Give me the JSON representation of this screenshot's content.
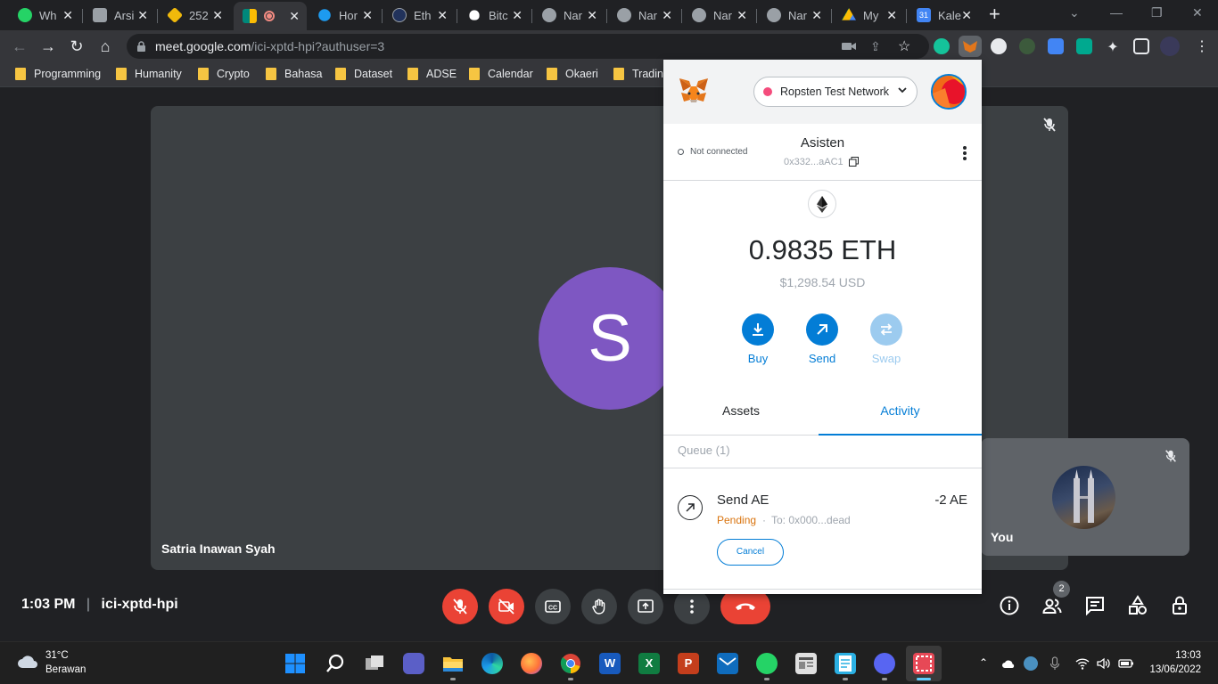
{
  "tabs": [
    {
      "title": "Wh",
      "favicon": "whatsapp-icon",
      "color": "#25d366"
    },
    {
      "title": "Arsi",
      "favicon": "contact-icon",
      "color": "#9aa0a6"
    },
    {
      "title": "252",
      "favicon": "binance-icon",
      "color": "#f0b90b"
    },
    {
      "title": "",
      "favicon": "google-meet-icon",
      "color": "#00897b",
      "recording": true,
      "active": true
    },
    {
      "title": "Hor",
      "favicon": "twitter-icon",
      "color": "#1d9bf0"
    },
    {
      "title": "Eth",
      "favicon": "etherscan-icon",
      "color": "#21325b"
    },
    {
      "title": "Bitc",
      "favicon": "bitcoin-icon",
      "color": "#ffffff"
    },
    {
      "title": "Nar",
      "favicon": "globe-icon",
      "color": "#9aa0a6"
    },
    {
      "title": "Nar",
      "favicon": "globe-icon",
      "color": "#9aa0a6"
    },
    {
      "title": "Nar",
      "favicon": "globe-icon",
      "color": "#9aa0a6"
    },
    {
      "title": "Nar",
      "favicon": "globe-icon",
      "color": "#9aa0a6"
    },
    {
      "title": "My",
      "favicon": "google-drive-icon",
      "color": "#fbbc04"
    },
    {
      "title": "Kale",
      "favicon": "google-calendar-icon",
      "color": "#4285f4"
    }
  ],
  "calendar_favicon_text": "31",
  "address_bar": {
    "domain": "meet.google.com",
    "path": "/ici-xptd-hpi?authuser=3"
  },
  "bookmarks": [
    "Programming",
    "Humanity",
    "Crypto",
    "Bahasa",
    "Dataset",
    "ADSE",
    "Calendar",
    "Okaeri",
    "Trading"
  ],
  "meet": {
    "presenter_initial": "S",
    "presenter_name": "Satria Inawan Syah",
    "self_label": "You",
    "time": "1:03 PM",
    "separator": "|",
    "meeting_code": "ici-xptd-hpi",
    "people_count": "2",
    "avatar_color": "#7e57c2"
  },
  "metamask": {
    "network": "Ropsten Test Network",
    "connection_status": "Not connected",
    "account_name": "Asisten",
    "account_address": "0x332...aAC1",
    "balance": "0.9835 ETH",
    "balance_usd": "$1,298.54 USD",
    "actions": [
      {
        "label": "Buy",
        "icon": "download-icon",
        "enabled": true
      },
      {
        "label": "Send",
        "icon": "arrow-up-right-icon",
        "enabled": true
      },
      {
        "label": "Swap",
        "icon": "swap-icon",
        "enabled": false
      }
    ],
    "tabs": {
      "assets": "Assets",
      "activity": "Activity",
      "selected": "Activity"
    },
    "queue_label": "Queue (1)",
    "transaction": {
      "title": "Send AE",
      "amount": "-2 AE",
      "status": "Pending",
      "separator": "·",
      "to": "To: 0x000...dead",
      "cancel_label": "Cancel"
    },
    "accent_color": "#037dd6"
  },
  "taskbar": {
    "weather_temp": "31°C",
    "weather_desc": "Berawan",
    "time": "13:03",
    "date": "13/06/2022",
    "apps": [
      "start-icon",
      "search-icon",
      "task-view-icon",
      "teams-chat-icon",
      "file-explorer-icon",
      "edge-icon",
      "firefox-icon",
      "chrome-icon",
      "word-icon",
      "excel-icon",
      "powerpoint-icon",
      "mail-icon",
      "whatsapp-icon",
      "news-icon",
      "notepad-icon",
      "discord-icon",
      "snipping-tool-icon"
    ]
  }
}
